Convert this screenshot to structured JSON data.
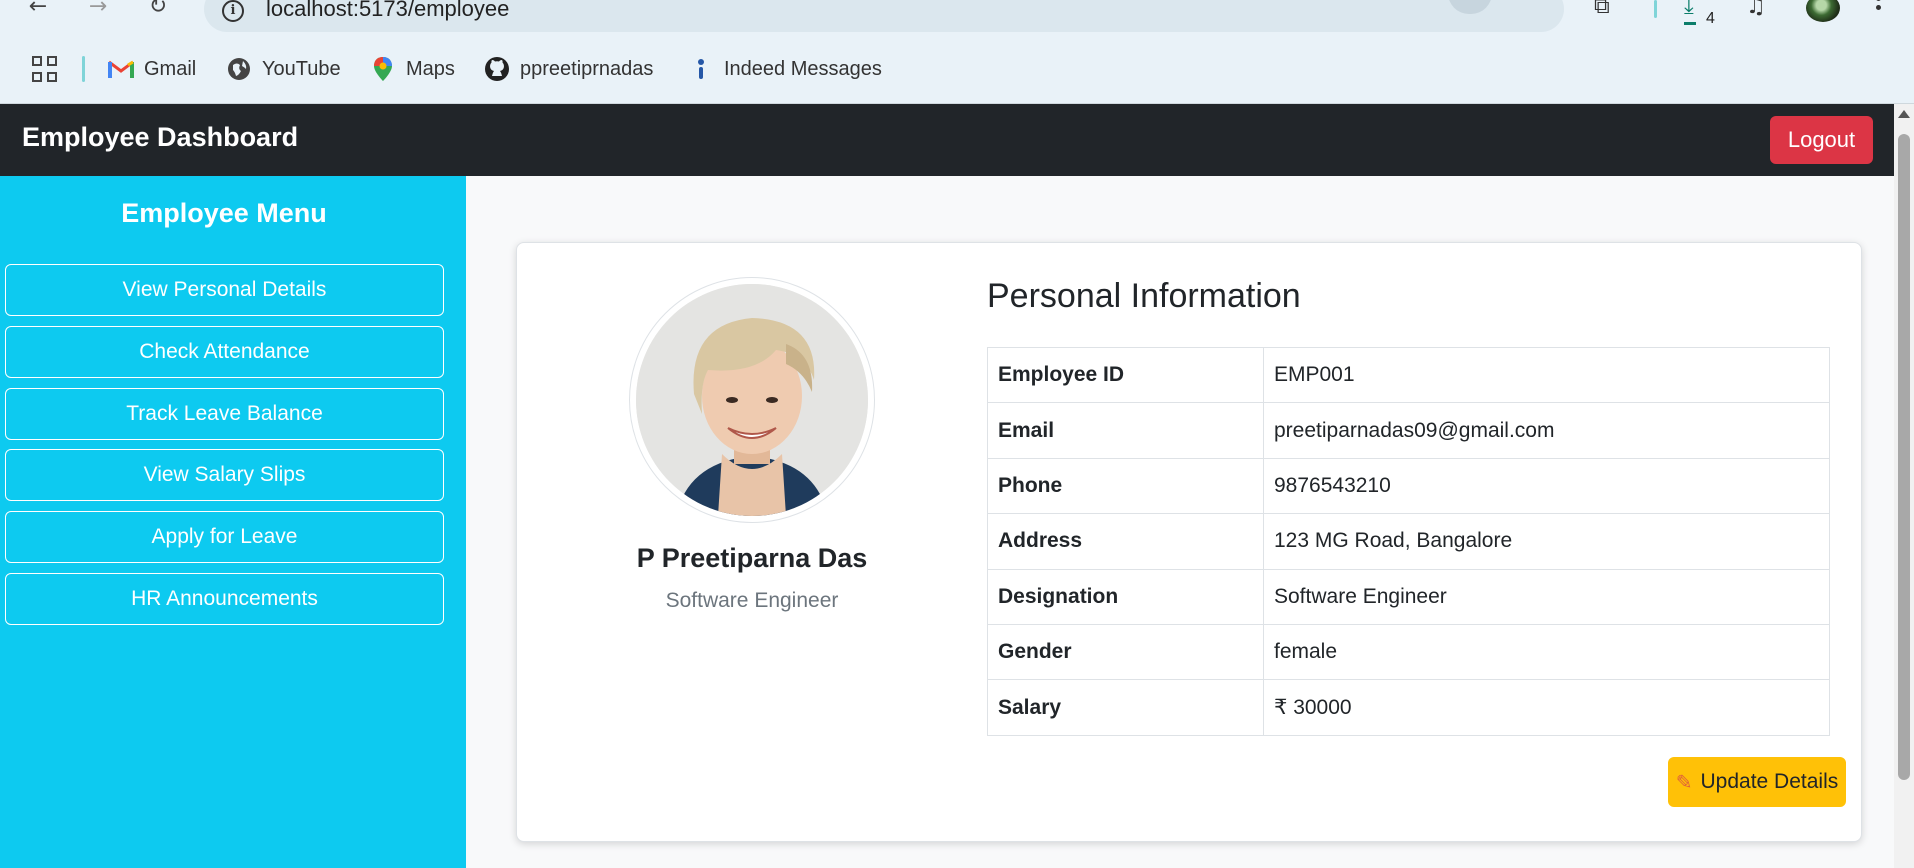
{
  "browser": {
    "url": "localhost:5173/employee",
    "download_count": "4",
    "bookmarks": [
      {
        "label": "Gmail",
        "icon": "gmail-icon"
      },
      {
        "label": "YouTube",
        "icon": "globe-icon"
      },
      {
        "label": "Maps",
        "icon": "maps-pin-icon"
      },
      {
        "label": "ppreetiprnadas",
        "icon": "github-icon"
      },
      {
        "label": "Indeed Messages",
        "icon": "indeed-icon"
      }
    ]
  },
  "header": {
    "brand": "Employee Dashboard",
    "logout_label": "Logout",
    "colors": {
      "bar": "#212529",
      "logout": "#dc3545"
    }
  },
  "sidebar": {
    "title": "Employee Menu",
    "color": "#0dcaf0",
    "items": [
      {
        "label": "View Personal Details"
      },
      {
        "label": "Check Attendance"
      },
      {
        "label": "Track Leave Balance"
      },
      {
        "label": "View Salary Slips"
      },
      {
        "label": "Apply for Leave"
      },
      {
        "label": "HR Announcements"
      }
    ]
  },
  "profile": {
    "name": "P Preetiparna Das",
    "role": "Software Engineer"
  },
  "personal_info": {
    "title": "Personal Information",
    "rows": [
      {
        "key": "Employee ID",
        "value": "EMP001"
      },
      {
        "key": "Email",
        "value": "preetiparnadas09@gmail.com"
      },
      {
        "key": "Phone",
        "value": "9876543210"
      },
      {
        "key": "Address",
        "value": "123 MG Road, Bangalore"
      },
      {
        "key": "Designation",
        "value": "Software Engineer"
      },
      {
        "key": "Gender",
        "value": "female"
      },
      {
        "key": "Salary",
        "value": "₹ 30000"
      }
    ]
  },
  "actions": {
    "update_label": "Update Details",
    "update_icon": "pencil-icon",
    "update_color": "#ffc107"
  }
}
